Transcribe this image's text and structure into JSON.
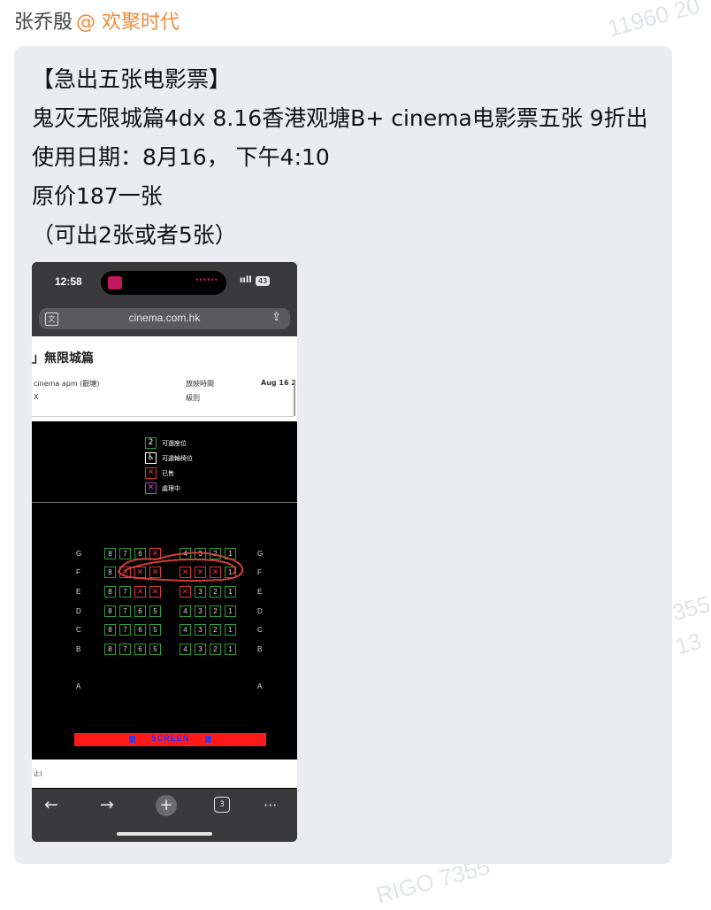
{
  "header": {
    "author": "张乔殷",
    "mention": "@ 欢聚时代"
  },
  "post": {
    "lines": [
      "【急出五张电影票】",
      "鬼灭无限城篇4dx 8.16香港观塘B+ cinema电影票五张 9折出",
      "使用日期：8月16， 下午4:10",
      "原价187一张",
      "（可出2张或者5张）"
    ]
  },
  "watermarks": [
    "11960 20",
    "355",
    "13",
    "RIGO 7355"
  ],
  "screenshot": {
    "status": {
      "time": "12:58",
      "signal": "ııll",
      "battery": "43"
    },
    "url": "cinema.com.hk",
    "movie_title": "」無限城篇",
    "venue": "cinema apm (觀塘)",
    "venue_line2": "X",
    "showtime_label": "放映時間",
    "rating_label": "級別",
    "date": "Aug 16 2",
    "legend": [
      {
        "symbol": "2",
        "label": "可選座位",
        "color": "#2e9e3a"
      },
      {
        "symbol": "♿",
        "label": "可選輪椅位",
        "color": "#ffffff"
      },
      {
        "symbol": "✕",
        "label": "已售",
        "color": "#d23b3b"
      },
      {
        "symbol": "✕",
        "label": "處理中",
        "color": "#b04bb8"
      }
    ],
    "seat_rows": [
      {
        "row": "G",
        "left": [
          "8",
          "7",
          "6",
          "X"
        ],
        "right": [
          "4",
          "3",
          "2",
          "1"
        ]
      },
      {
        "row": "F",
        "left": [
          "8",
          "X",
          "X",
          "X"
        ],
        "right": [
          "X",
          "X",
          "X",
          "1"
        ]
      },
      {
        "row": "E",
        "left": [
          "8",
          "7",
          "X",
          "X"
        ],
        "right": [
          "X",
          "3",
          "2",
          "1"
        ]
      },
      {
        "row": "D",
        "left": [
          "8",
          "7",
          "6",
          "5"
        ],
        "right": [
          "4",
          "3",
          "2",
          "1"
        ]
      },
      {
        "row": "C",
        "left": [
          "8",
          "7",
          "6",
          "5"
        ],
        "right": [
          "4",
          "3",
          "2",
          "1"
        ]
      },
      {
        "row": "B",
        "left": [
          "8",
          "7",
          "6",
          "5"
        ],
        "right": [
          "4",
          "3",
          "2",
          "1"
        ]
      },
      {
        "row": "A",
        "left": [],
        "right": []
      }
    ],
    "screen_label": "SCREEN",
    "bottom_note": "止)",
    "toolbar": {
      "back": "←",
      "forward": "→",
      "new_tab": "+",
      "tab_count": "3",
      "more": "···"
    },
    "annotation_color": "#e8453c"
  }
}
